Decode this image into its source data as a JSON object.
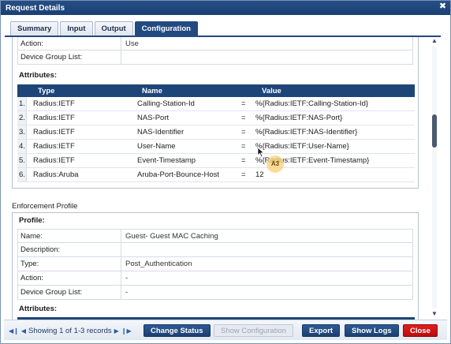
{
  "window": {
    "title": "Request Details"
  },
  "tabs": [
    {
      "label": "Summary"
    },
    {
      "label": "Input"
    },
    {
      "label": "Output"
    },
    {
      "label": "Configuration"
    }
  ],
  "top_partial": {
    "action_label": "Action:",
    "action_value": "Use",
    "device_group_label": "Device Group List:",
    "device_group_value": ""
  },
  "attributes": {
    "label": "Attributes:",
    "columns": {
      "type": "Type",
      "name": "Name",
      "value": "Value"
    },
    "rows": [
      {
        "idx": "1.",
        "type": "Radius:IETF",
        "name": "Calling-Station-Id",
        "op": "=",
        "value": "%{Radius:IETF:Calling-Station-Id}"
      },
      {
        "idx": "2.",
        "type": "Radius:IETF",
        "name": "NAS-Port",
        "op": "=",
        "value": "%{Radius:IETF:NAS-Port}"
      },
      {
        "idx": "3.",
        "type": "Radius:IETF",
        "name": "NAS-Identifier",
        "op": "=",
        "value": "%{Radius:IETF:NAS-Identifier}"
      },
      {
        "idx": "4.",
        "type": "Radius:IETF",
        "name": "User-Name",
        "op": "=",
        "value": "%{Radius:IETF:User-Name}"
      },
      {
        "idx": "5.",
        "type": "Radius:IETF",
        "name": "Event-Timestamp",
        "op": "=",
        "value": "%{Radius:IETF:Event-Timestamp}"
      },
      {
        "idx": "6.",
        "type": "Radius:Aruba",
        "name": "Aruba-Port-Bounce-Host",
        "op": "=",
        "value": "12"
      }
    ]
  },
  "enforcement": {
    "section_title": "Enforcement Profile",
    "profile_label": "Profile:",
    "fields": [
      {
        "label": "Name:",
        "value": "Guest- Guest MAC Caching"
      },
      {
        "label": "Description:",
        "value": ""
      },
      {
        "label": "Type:",
        "value": "Post_Authentication"
      },
      {
        "label": "Action:",
        "value": "-"
      },
      {
        "label": "Device Group List:",
        "value": "-"
      }
    ],
    "attributes_label": "Attributes:"
  },
  "overlay": {
    "badge": "A3"
  },
  "footer": {
    "pager_text": "Showing 1 of 1-3 records",
    "buttons": {
      "change_status": "Change Status",
      "show_configuration": "Show Configuration",
      "export": "Export",
      "show_logs": "Show Logs",
      "close": "Close"
    }
  }
}
